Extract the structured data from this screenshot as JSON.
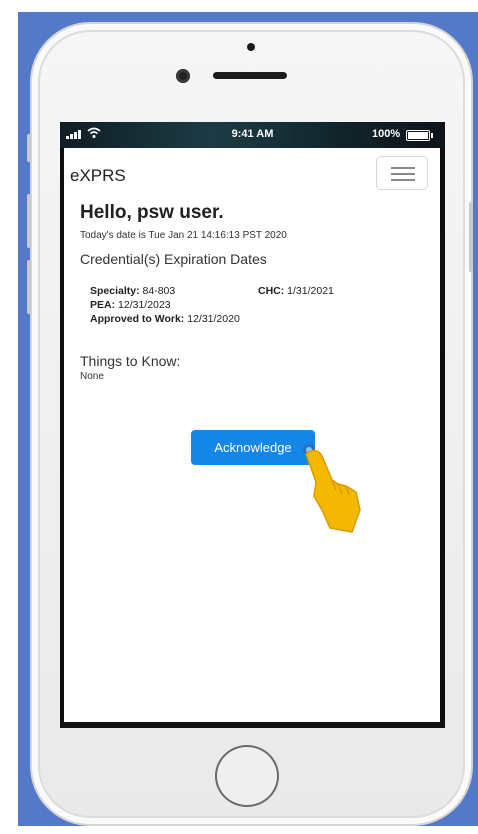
{
  "status_bar": {
    "time": "9:41 AM",
    "battery": "100%",
    "signal_icon": "cellular-signal-icon",
    "wifi_icon": "wifi-icon",
    "battery_icon": "battery-full-icon"
  },
  "navbar": {
    "brand": "eXPRS",
    "menu_icon": "hamburger-menu-icon"
  },
  "main": {
    "greeting": "Hello, psw user.",
    "date_line": "Today's date is Tue Jan 21 14:16:13 PST 2020",
    "credentials_title": "Credential(s) Expiration Dates",
    "credentials": [
      {
        "label": "Specialty:",
        "value": "84-803"
      },
      {
        "label": "CHC:",
        "value": "1/31/2021"
      },
      {
        "label": "PEA:",
        "value": "12/31/2023"
      },
      {
        "label": "Approved to Work:",
        "value": "12/31/2020"
      }
    ],
    "things_title": "Things to Know:",
    "things_value": "None",
    "acknowledge_label": "Acknowledge"
  },
  "colors": {
    "backdrop": "#5479c8",
    "button": "#1486e8",
    "hand": "#f5b800"
  }
}
